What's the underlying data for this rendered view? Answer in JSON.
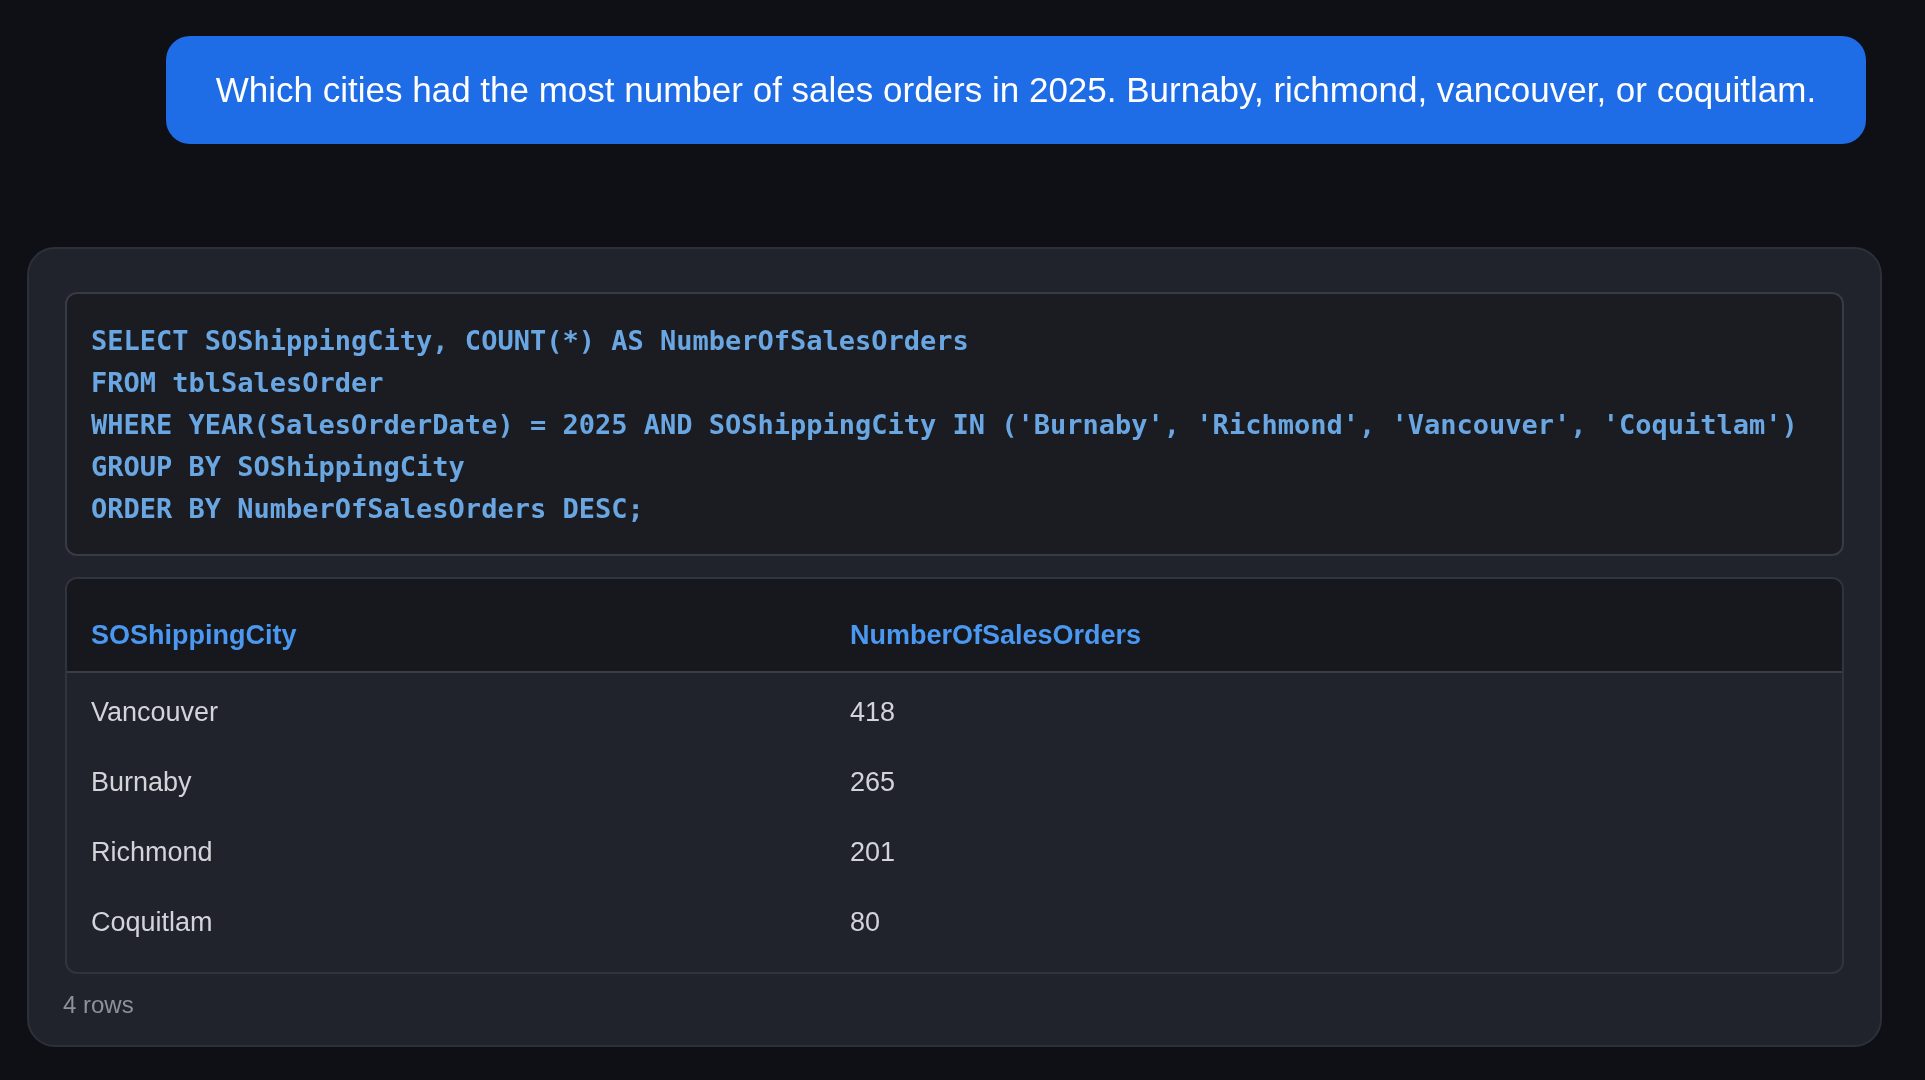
{
  "message": {
    "text": "Which cities had the most number of sales orders in 2025. Burnaby, richmond, vancouver, or coquitlam."
  },
  "result_card": {
    "sql_lines": [
      "SELECT SOShippingCity, COUNT(*) AS NumberOfSalesOrders",
      "FROM tblSalesOrder",
      "WHERE YEAR(SalesOrderDate) = 2025 AND SOShippingCity IN ('Burnaby', 'Richmond', 'Vancouver', 'Coquitlam')",
      "GROUP BY SOShippingCity",
      "ORDER BY NumberOfSalesOrders DESC;"
    ],
    "table": {
      "columns": [
        "SOShippingCity",
        "NumberOfSalesOrders"
      ],
      "rows": [
        [
          "Vancouver",
          "418"
        ],
        [
          "Burnaby",
          "265"
        ],
        [
          "Richmond",
          "201"
        ],
        [
          "Coquitlam",
          "80"
        ]
      ]
    },
    "row_count": "4 rows"
  }
}
